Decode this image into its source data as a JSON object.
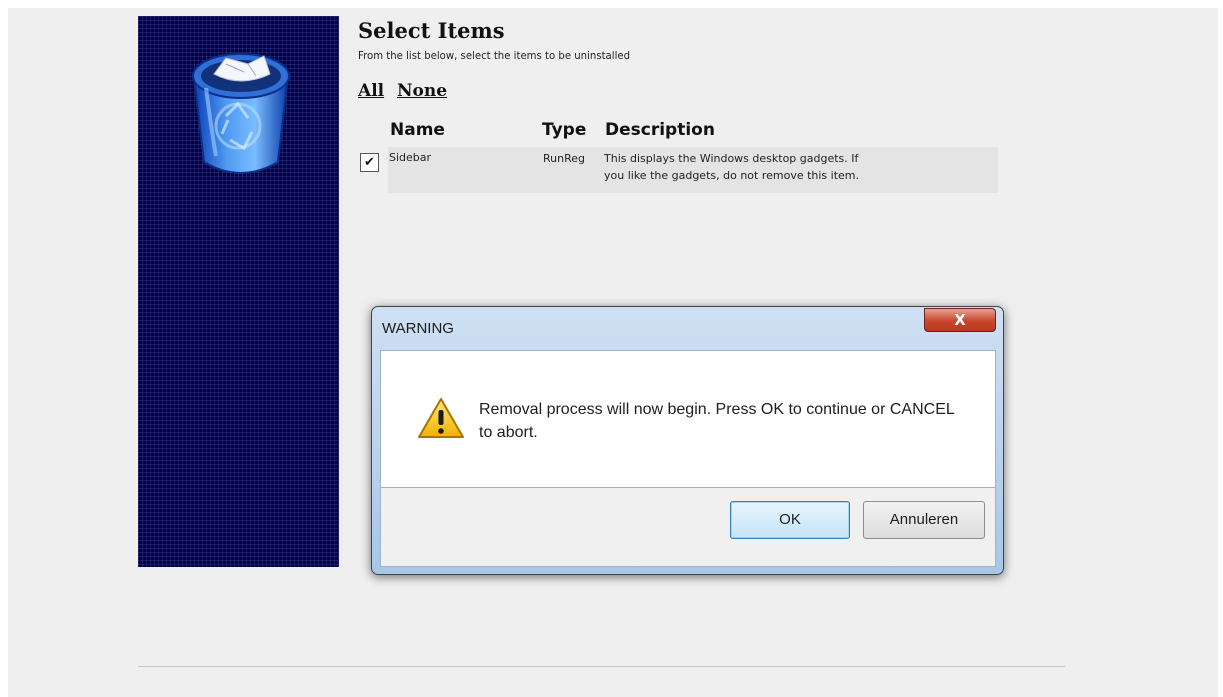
{
  "header": {
    "title": "Select Items",
    "subtitle": "From the list below, select the items to be uninstalled"
  },
  "selection": {
    "all_label": "All",
    "none_label": "None"
  },
  "table": {
    "columns": [
      "Name",
      "Type",
      "Description"
    ],
    "rows": [
      {
        "checked": true,
        "name": "Sidebar",
        "type": "RunReg",
        "description_line1": "This displays the Windows desktop gadgets. If",
        "description_line2": "you like the gadgets, do not remove this item."
      }
    ]
  },
  "dialog": {
    "title": "WARNING",
    "close_glyph": "X",
    "message": "Removal process will now begin.  Press OK to continue or CANCEL to abort.",
    "ok_label": "OK",
    "cancel_label": "Annuleren",
    "icon": "warning-icon"
  },
  "icons": {
    "side_panel": "recycle-bin-icon"
  },
  "colors": {
    "side_panel_bg": "#000044",
    "page_bg": "#efefef"
  }
}
